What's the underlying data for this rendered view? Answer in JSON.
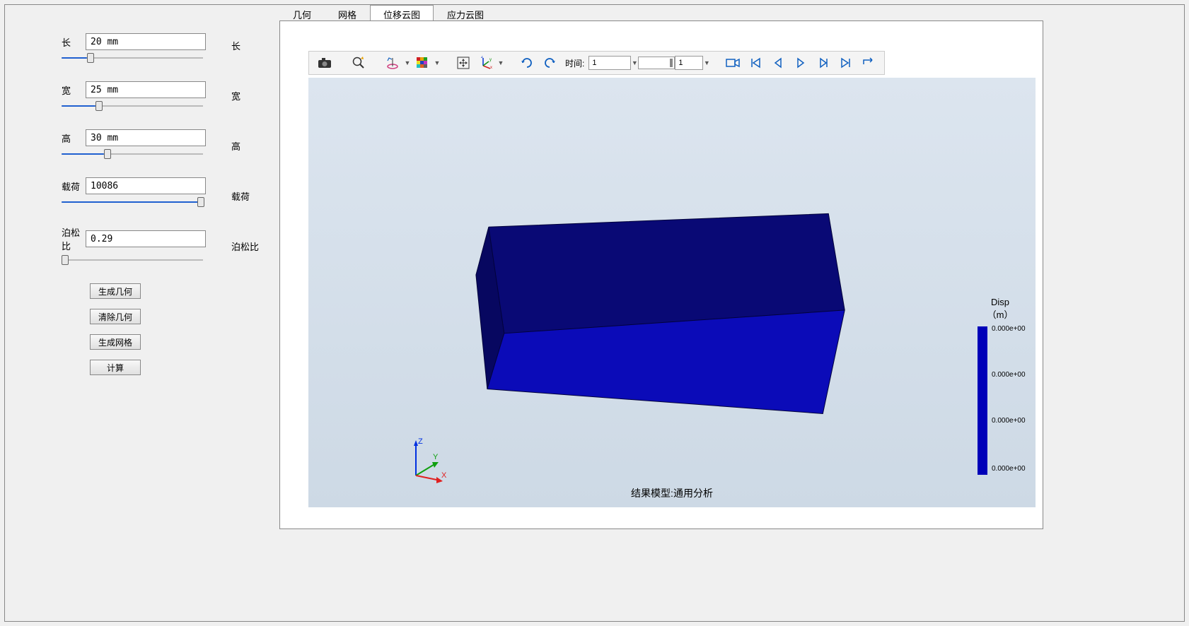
{
  "params": {
    "length": {
      "label": "长",
      "value": "20 mm",
      "slider_pct": 18
    },
    "width": {
      "label": "宽",
      "value": "25 mm",
      "slider_pct": 24
    },
    "height": {
      "label": "高",
      "value": "30 mm",
      "slider_pct": 30
    },
    "load": {
      "label": "载荷",
      "value": "10086",
      "slider_pct": 98
    },
    "poisson": {
      "label": "泊松比",
      "value": "0.29",
      "slider_pct": 0
    }
  },
  "right_labels": [
    "长",
    "宽",
    "高",
    "载荷",
    "泊松比"
  ],
  "buttons": {
    "gen_geom": "生成几何",
    "clear_geom": "清除几何",
    "gen_mesh": "生成网格",
    "compute": "计算"
  },
  "tabs": {
    "items": [
      "几何",
      "网格",
      "位移云图",
      "应力云图"
    ],
    "active_index": 2
  },
  "toolbar": {
    "time_label": "时间:",
    "time_value": "1",
    "step_value": "1"
  },
  "viewport": {
    "model_label": "结果模型:通用分析",
    "axes": {
      "x": "X",
      "y": "Y",
      "z": "Z"
    }
  },
  "legend": {
    "title_line1": "Disp",
    "title_line2": "（m）",
    "ticks": [
      "0.000e+00",
      "0.000e+00",
      "0.000e+00",
      "0.000e+00"
    ]
  }
}
